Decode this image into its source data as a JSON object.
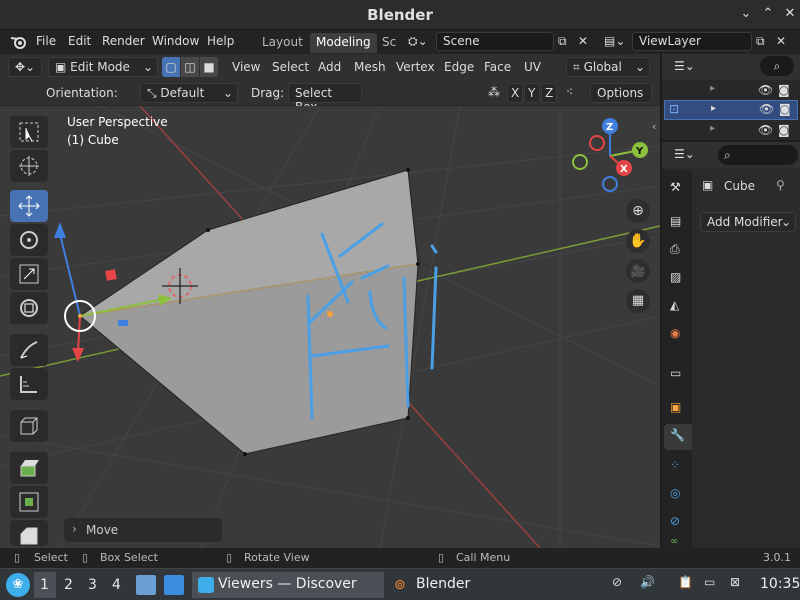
{
  "window": {
    "title": "Blender"
  },
  "menubar": {
    "items": [
      "File",
      "Edit",
      "Render",
      "Window",
      "Help"
    ],
    "workspaces": [
      "Layout",
      "Modeling",
      "Sc"
    ],
    "scene": "Scene",
    "view_layer": "ViewLayer"
  },
  "viewport_header": {
    "mode": "Edit Mode",
    "menus": [
      "View",
      "Select",
      "Add",
      "Mesh",
      "Vertex",
      "Edge",
      "Face",
      "UV"
    ],
    "transform": "Global"
  },
  "tool_settings": {
    "orientation_label": "Orientation:",
    "orientation_value": "Default",
    "drag_label": "Drag:",
    "drag_value": "Select Box",
    "axes": [
      "X",
      "Y",
      "Z"
    ],
    "options": "Options"
  },
  "viewport": {
    "perspective": "User Perspective",
    "object": "(1) Cube",
    "last_op": "Move",
    "gizmo": {
      "x": "X",
      "y": "Y",
      "z": "Z"
    }
  },
  "properties": {
    "object_name": "Cube",
    "add_modifier": "Add Modifier"
  },
  "statusbar": {
    "select": "Select",
    "box_select": "Box Select",
    "rotate": "Rotate View",
    "call_menu": "Call Menu",
    "version": "3.0.1"
  },
  "taskbar": {
    "desktops": [
      "1",
      "2",
      "3",
      "4"
    ],
    "task1": "Viewers — Discover",
    "task2": "Blender",
    "clock": "10:35"
  },
  "colors": {
    "accent": "#4772b3",
    "x_axis": "#e54545",
    "y_axis": "#8cbf3b",
    "z_axis": "#3f7fe0"
  }
}
